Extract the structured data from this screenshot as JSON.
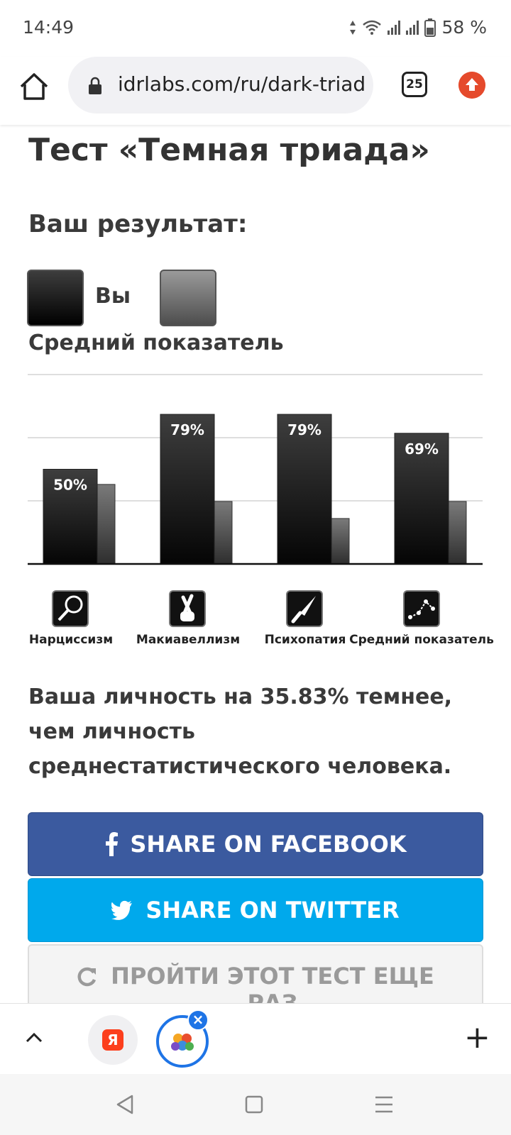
{
  "status_bar": {
    "time": "14:49",
    "battery": "58 %"
  },
  "browser": {
    "url": "idrlabs.com/ru/dark-triad",
    "tab_count": "25"
  },
  "page": {
    "title": "Тест «Темная триада»",
    "result_heading": "Ваш результат:",
    "legend_you": "Вы",
    "legend_average": "Средний показатель",
    "result_text": "Ваша личность на 35.83% темнее, чем личность среднестатистического человека."
  },
  "chart_data": {
    "type": "bar",
    "categories": [
      "Нарциссизм",
      "Макиавеллизм",
      "Психопатия",
      "Средний показатель"
    ],
    "series": [
      {
        "name": "Вы",
        "values": [
          50,
          79,
          79,
          69
        ],
        "labels": [
          "50%",
          "79%",
          "79%",
          "69%"
        ],
        "color": "#111111"
      },
      {
        "name": "Средний показатель",
        "values": [
          42,
          33,
          24,
          33
        ],
        "color": "#6a6a6a"
      }
    ],
    "ylim": [
      0,
      100
    ],
    "grid": true
  },
  "buttons": {
    "facebook": "SHARE ON FACEBOOK",
    "twitter": "SHARE ON TWITTER",
    "retake": "ПРОЙТИ ЭТОТ ТЕСТ ЕЩЕ РАЗ"
  },
  "toolbar": {
    "yandex_letter": "Я"
  },
  "colors": {
    "facebook": "#3b5a9f",
    "twitter": "#00a9ec",
    "update": "#e54a2c",
    "alice": "#1e74e6"
  }
}
